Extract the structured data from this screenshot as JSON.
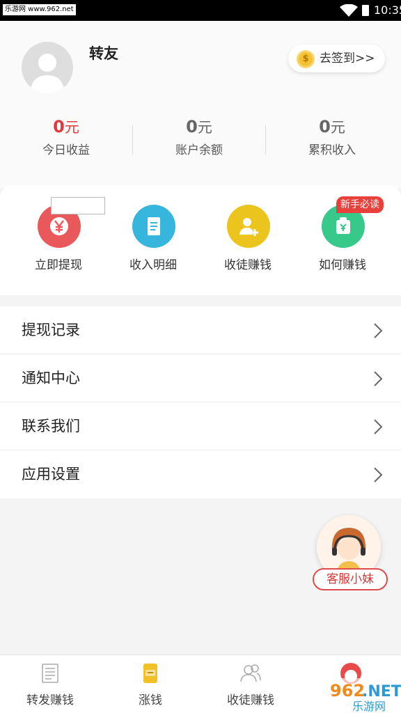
{
  "status_bar": {
    "watermark": "乐游网 www.962.net",
    "time": "10:35"
  },
  "profile": {
    "name": "转友",
    "checkin_label": "去签到>>"
  },
  "stats": [
    {
      "value": "0",
      "unit": "元",
      "label": "今日收益"
    },
    {
      "value": "0",
      "unit": "元",
      "label": "账户余额"
    },
    {
      "value": "0",
      "unit": "元",
      "label": "累积收入"
    }
  ],
  "quick_actions": [
    {
      "label": "立即提现",
      "icon": "yen-icon",
      "color": "#e9585a"
    },
    {
      "label": "收入明细",
      "icon": "document-icon",
      "color": "#36b6dc"
    },
    {
      "label": "收徒赚钱",
      "icon": "add-user-icon",
      "color": "#ebc51e"
    },
    {
      "label": "如何赚钱",
      "icon": "money-bag-icon",
      "color": "#37c98a"
    }
  ],
  "new_badge": "新手必读",
  "menu": [
    {
      "label": "提现记录"
    },
    {
      "label": "通知中心"
    },
    {
      "label": "联系我们"
    },
    {
      "label": "应用设置"
    }
  ],
  "customer_service": {
    "label": "客服小妹"
  },
  "tabs": [
    {
      "label": "转发赚钱",
      "icon": "newspaper-icon"
    },
    {
      "label": "涨钱",
      "icon": "scroll-icon"
    },
    {
      "label": "收徒赚钱",
      "icon": "users-icon"
    },
    {
      "label": "",
      "icon": "profile-icon"
    }
  ],
  "watermark_corner": "962.NET 乐游网",
  "colors": {
    "accent_red": "#e03a3a",
    "background": "#f4f4f4"
  }
}
